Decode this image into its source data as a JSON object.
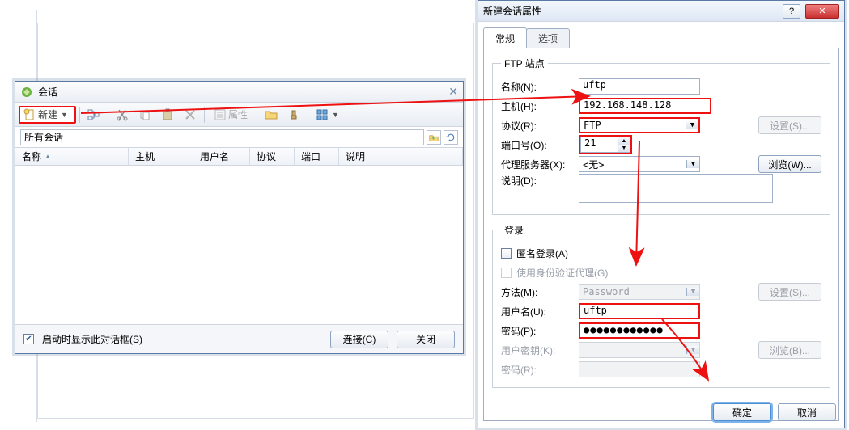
{
  "sessions_window": {
    "title": "会话",
    "toolbar": {
      "new_label": "新建",
      "properties_label": "属性"
    },
    "filter_text": "所有会话",
    "columns": {
      "name": "名称",
      "host": "主机",
      "user": "用户名",
      "protocol": "协议",
      "port": "端口",
      "desc": "说明"
    },
    "footer": {
      "startup_checkbox": "启动时显示此对话框(S)",
      "connect": "连接(C)",
      "close": "关闭"
    }
  },
  "props_window": {
    "title": "新建会话属性",
    "tabs": {
      "general": "常规",
      "options": "选项"
    },
    "ftp_group": {
      "legend": "FTP 站点",
      "name_label": "名称(N):",
      "name_value": "uftp",
      "host_label": "主机(H):",
      "host_value": "192.168.148.128",
      "protocol_label": "协议(R):",
      "protocol_value": "FTP",
      "settings_btn": "设置(S)...",
      "port_label": "端口号(O):",
      "port_value": "21",
      "proxy_label": "代理服务器(X):",
      "proxy_value": "<无>",
      "browse_btn": "浏览(W)...",
      "desc_label": "说明(D):"
    },
    "login_group": {
      "legend": "登录",
      "anonymous": "匿名登录(A)",
      "use_auth_agent": "使用身份验证代理(G)",
      "method_label": "方法(M):",
      "method_value": "Password",
      "settings_btn": "设置(S)...",
      "user_label": "用户名(U):",
      "user_value": "uftp",
      "pass_label": "密码(P):",
      "pass_value": "●●●●●●●●●●●●",
      "key_label": "用户密钥(K):",
      "browse_btn": "浏览(B)...",
      "passphrase_label": "密码(R):"
    },
    "footer": {
      "ok": "确定",
      "cancel": "取消"
    }
  }
}
